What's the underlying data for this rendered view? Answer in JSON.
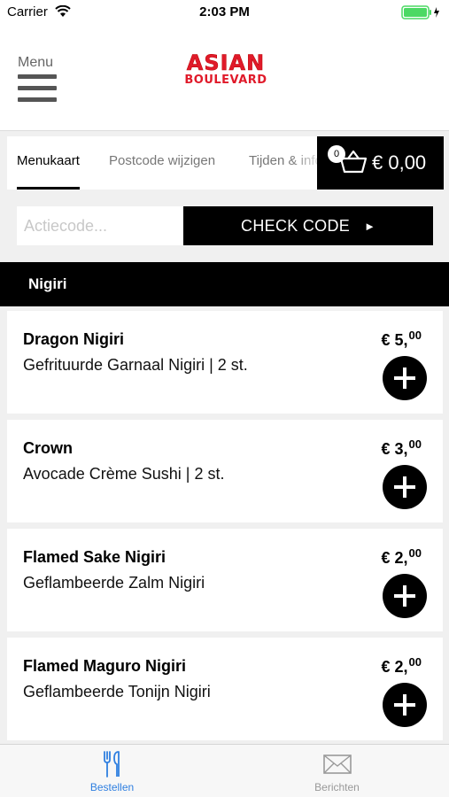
{
  "status_bar": {
    "carrier": "Carrier",
    "time": "2:03 PM"
  },
  "header": {
    "menu_label": "Menu",
    "logo_line1": "ASIAN",
    "logo_line2": "BOULEVARD"
  },
  "tabs": [
    {
      "label": "Menukaart",
      "active": true
    },
    {
      "label": "Postcode wijzigen",
      "active": false
    },
    {
      "label": "Tijden & info",
      "active": false
    }
  ],
  "cart": {
    "count": "0",
    "total": "€ 0,00"
  },
  "code": {
    "placeholder": "Actiecode...",
    "value": "",
    "button_label": "CHECK CODE"
  },
  "section": {
    "title": "Nigiri"
  },
  "products": [
    {
      "name": "Dragon Nigiri",
      "description": "Gefrituurde Garnaal Nigiri | 2 st.",
      "price_main": "€ 5,",
      "price_cents": "00"
    },
    {
      "name": "Crown",
      "description": "Avocade Crème Sushi | 2 st.",
      "price_main": "€ 3,",
      "price_cents": "00"
    },
    {
      "name": "Flamed Sake Nigiri",
      "description": "Geflambeerde Zalm Nigiri",
      "price_main": "€ 2,",
      "price_cents": "00"
    },
    {
      "name": "Flamed Maguro Nigiri",
      "description": "Geflambeerde Tonijn Nigiri",
      "price_main": "€ 2,",
      "price_cents": "00"
    }
  ],
  "tab_bar": [
    {
      "label": "Bestellen",
      "icon": "fork-knife-icon",
      "active": true
    },
    {
      "label": "Berichten",
      "icon": "envelope-icon",
      "active": false
    }
  ],
  "colors": {
    "accent": "#2f7fe0",
    "brand_red": "#e01a2a",
    "dark": "#000000"
  }
}
